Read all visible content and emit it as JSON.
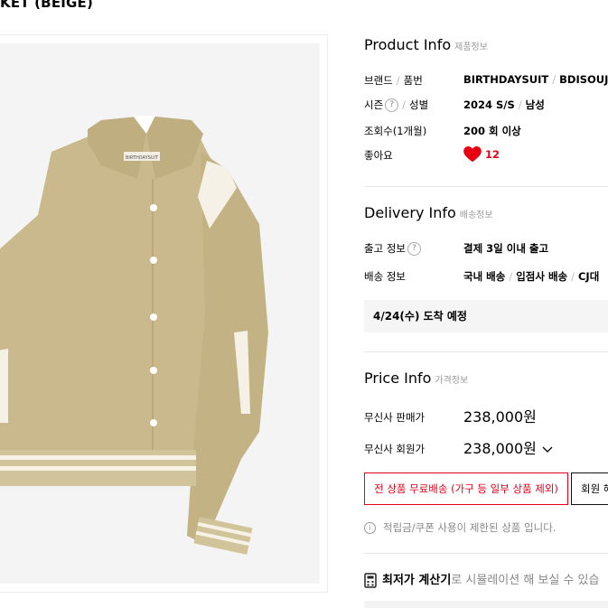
{
  "page": {
    "title": "KET (BEIGE)"
  },
  "product_image": {
    "brand_tag": "BIRTHDAYSUIT"
  },
  "product_info": {
    "title": "Product Info",
    "subtitle": "제품정보",
    "brand_label_1": "브랜드",
    "brand_label_2": "품번",
    "brand_value": "BIRTHDAYSUIT",
    "code_value": "BDISOUJK",
    "season_label": "시즌",
    "gender_label": "성별",
    "season_value": "2024 S/S",
    "gender_value": "남성",
    "views_label": "조회수(1개월)",
    "views_value": "200 회 이상",
    "likes_label": "좋아요",
    "likes_value": "12"
  },
  "delivery_info": {
    "title": "Delivery Info",
    "subtitle": "배송정보",
    "release_label": "출고 정보",
    "release_value": "결제 3일 이내 출고",
    "shipping_label": "배송 정보",
    "shipping_1": "국내 배송",
    "shipping_2": "입점사 배송",
    "shipping_3": "CJ대",
    "arrival": "4/24(수) 도착 예정"
  },
  "price_info": {
    "title": "Price Info",
    "subtitle": "가격정보",
    "sale_label": "무신사 판매가",
    "sale_value": "238,000원",
    "member_label": "무신사 회원가",
    "member_value": "238,000원"
  },
  "buttons": {
    "free_shipping": "전 상품 무료배송 (가구 등 일부 상품 제외)",
    "member_benefit": "회원 혜"
  },
  "notice": {
    "text": "적립금/쿠폰 사용이 제한된 상품 입니다."
  },
  "calculator": {
    "bold": "최저가 계산기",
    "rest": "로 시뮬레이션 해 보실 수 있습"
  },
  "colors": {
    "accent": "#e2001a",
    "jacket": "#c9b98c"
  },
  "icons": [
    "question-icon",
    "heart-icon",
    "chevron-down-icon",
    "info-icon",
    "calculator-icon"
  ]
}
